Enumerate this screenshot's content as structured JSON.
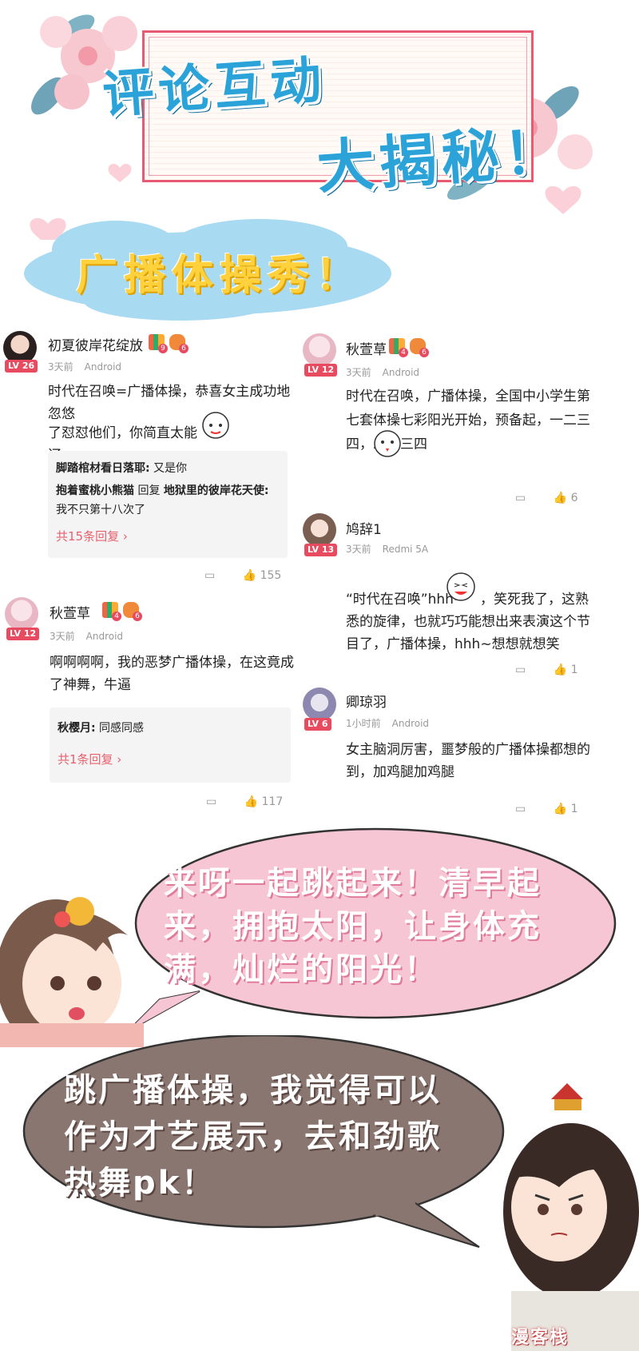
{
  "header": {
    "title_line1": "评论互动",
    "title_line2": "大揭秘！"
  },
  "cloud": {
    "text": "广播体操秀！"
  },
  "comments": [
    {
      "username": "初夏彼岸花绽放",
      "level": "LV 26",
      "badge1": "9",
      "badge2": "6",
      "time": "3天前",
      "device": "Android",
      "text_line1": "时代在召唤=广播体操，恭喜女主成功地忽悠",
      "text_line2": "了怼怼他们，你简直太能辽",
      "replies": [
        {
          "author": "脚踏棺材看日落耶:",
          "text": " 又是你"
        },
        {
          "author": "抱着蜜桃小熊猫",
          "middle": " 回复 ",
          "target": "地狱里的彼岸花天使:",
          "text": " 我不只第十八次了"
        }
      ],
      "more": "共15条回复 ›",
      "likes": "155"
    },
    {
      "username": "秋萱草",
      "level": "LV 12",
      "badge1": "4",
      "badge2": "6",
      "time": "3天前",
      "device": "Android",
      "text": "啊啊啊啊，我的恶梦广播体操，在这竟成了神舞，牛逼",
      "replies": [
        {
          "author": "秋樱月:",
          "text": " 同感同感"
        }
      ],
      "more": "共1条回复 ›",
      "likes": "117"
    },
    {
      "username": "秋萱草",
      "level": "LV 12",
      "badge1": "4",
      "badge2": "6",
      "time": "3天前",
      "device": "Android",
      "text": "时代在召唤，广播体操，全国中小学生第七套体操七彩阳光开始，预备起，一二三四，二二三四",
      "likes": "6"
    },
    {
      "username": "鸠辞1",
      "level": "LV 13",
      "time": "3天前",
      "device": "Redmi 5A",
      "text_part1": "“时代在召唤”hhh~",
      "text_part2": "，笑死我了，这熟悉的旋律，也就巧巧能想出来表演这个节目了，广播体操，hhh~想想就想笑",
      "likes": "1"
    },
    {
      "username": "卿琼羽",
      "level": "LV 6",
      "time": "1小时前",
      "device": "Android",
      "text": "女主脑洞厉害，噩梦般的广播体操都想的到，加鸡腿加鸡腿",
      "likes": "1"
    }
  ],
  "bubble1": {
    "text": "来呀一起跳起来！清早起来，拥抱太阳，让身体充满，灿烂的阳光！"
  },
  "bubble2": {
    "text": "跳广播体操，我觉得可以作为才艺展示，去和劲歌热舞pk！"
  },
  "watermark": "漫客栈",
  "colors": {
    "accent_pink": "#e84a5f",
    "title_blue": "#2ba3d8",
    "bubble_pink": "#f7c6d4",
    "bubble_brown": "#8a7670"
  }
}
